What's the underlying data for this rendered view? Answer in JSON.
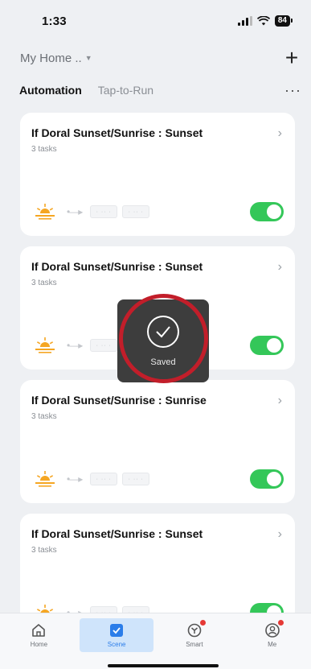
{
  "status": {
    "time": "1:33",
    "battery": "84"
  },
  "header": {
    "home_name": "My Home ..",
    "add_label": "+"
  },
  "tabs": [
    {
      "label": "Automation",
      "active": true
    },
    {
      "label": "Tap-to-Run",
      "active": false
    }
  ],
  "more_label": "···",
  "cards": [
    {
      "title": "If Doral Sunset/Sunrise : Sunset",
      "subtitle": "3 tasks",
      "enabled": true
    },
    {
      "title": "If Doral Sunset/Sunrise : Sunset",
      "subtitle": "3 tasks",
      "enabled": true
    },
    {
      "title": "If Doral Sunset/Sunrise : Sunrise",
      "subtitle": "3 tasks",
      "enabled": true
    },
    {
      "title": "If Doral Sunset/Sunrise : Sunset",
      "subtitle": "3 tasks",
      "enabled": true
    }
  ],
  "toast": {
    "label": "Saved",
    "icon": "check-circle-icon"
  },
  "nav": [
    {
      "label": "Home",
      "icon": "home-icon",
      "active": false,
      "badge": false
    },
    {
      "label": "Scene",
      "icon": "scene-checkbox-icon",
      "active": true,
      "badge": false
    },
    {
      "label": "Smart",
      "icon": "smart-icon",
      "active": false,
      "badge": true
    },
    {
      "label": "Me",
      "icon": "profile-icon",
      "active": false,
      "badge": true
    }
  ],
  "colors": {
    "toggle_on": "#34c759",
    "accent": "#2b7de9",
    "highlight": "#c21e2a",
    "sun": "#f5a623"
  }
}
